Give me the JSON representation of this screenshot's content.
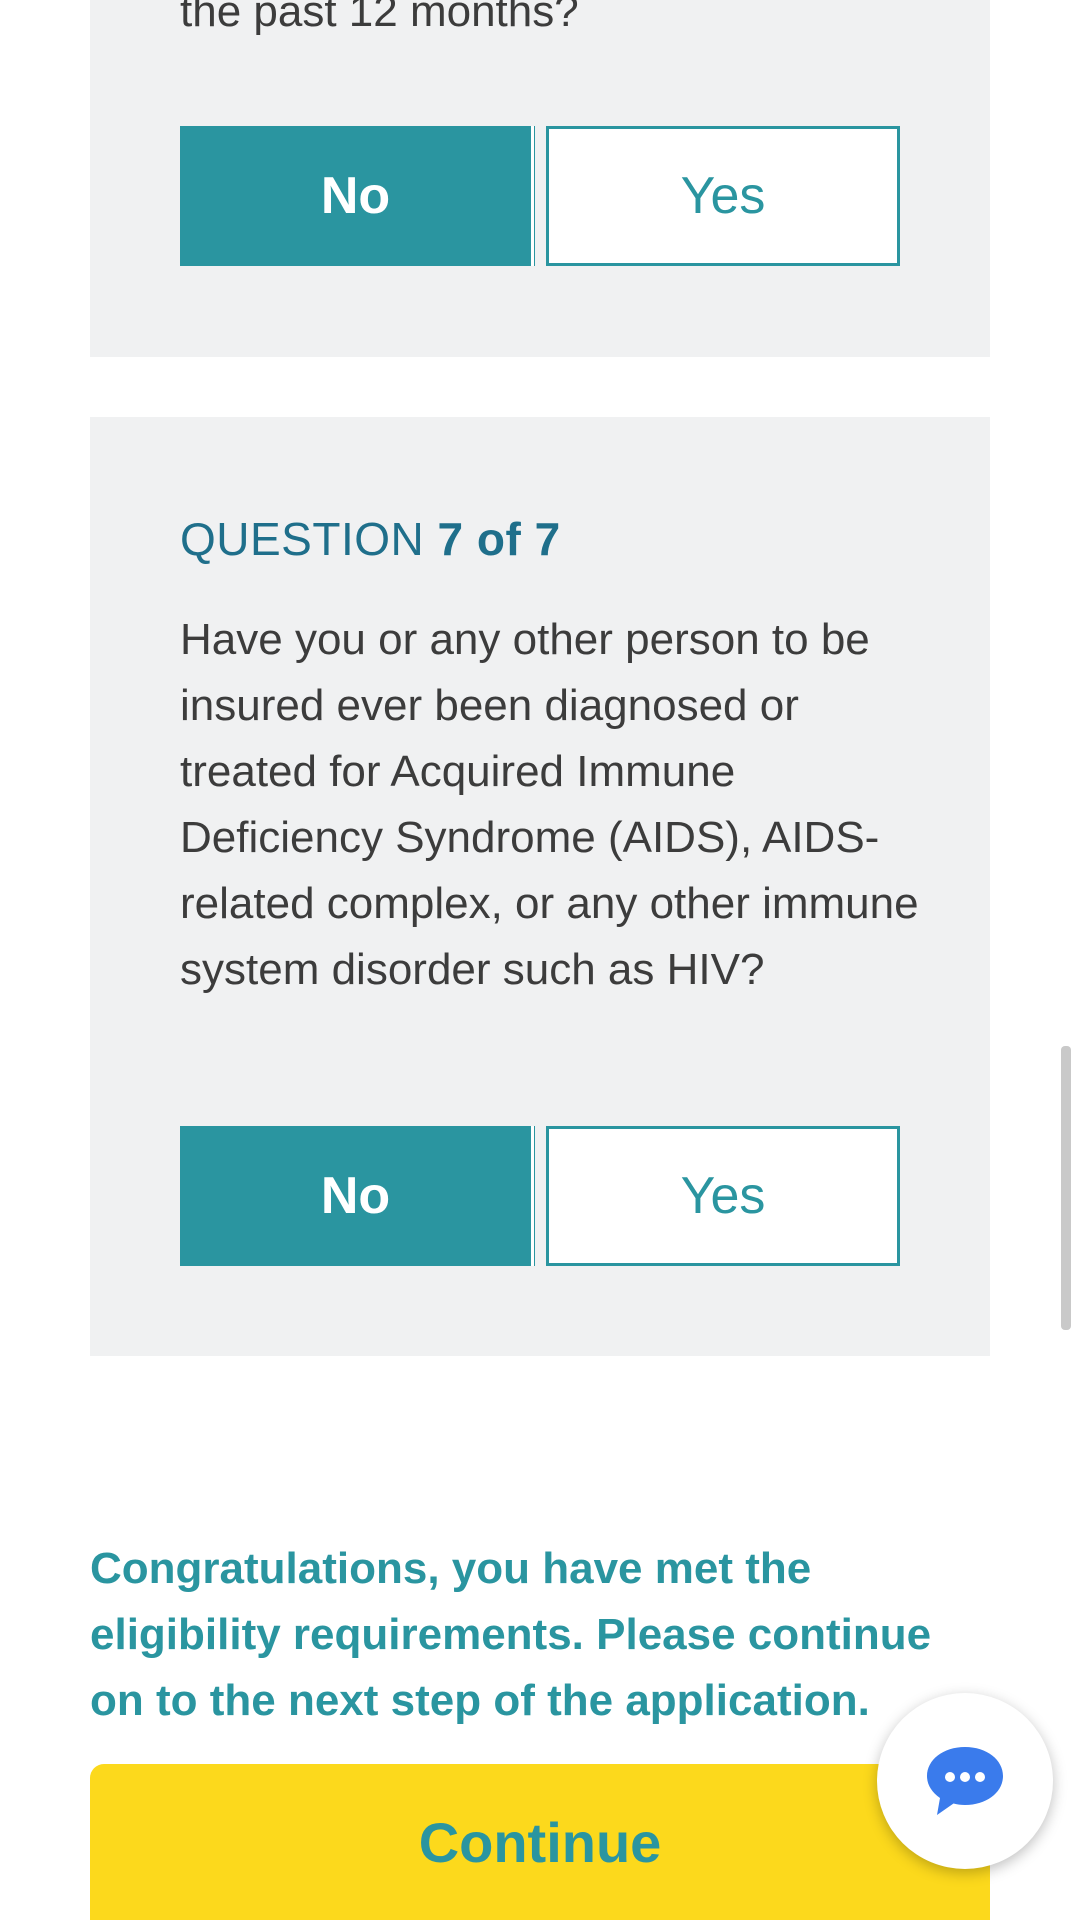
{
  "question6": {
    "text_tail": "the past 12 months?",
    "no_label": "No",
    "yes_label": "Yes"
  },
  "question7": {
    "label_prefix": "QUESTION",
    "label_number": "7 of 7",
    "text": "Have you or any other person to be insured ever been diagnosed or treated for Acquired Immune Deficiency Syndrome (AIDS), AIDS-related complex, or any other immune system disorder such as HIV?",
    "no_label": "No",
    "yes_label": "Yes"
  },
  "eligibility": {
    "message": "Congratulations, you have met the eligibility requirements. Please continue on to the next step of the application."
  },
  "continue_label": "Continue",
  "icons": {
    "chat": "chat-bubble-icon"
  },
  "colors": {
    "teal": "#2a95a0",
    "label_blue": "#1f6f8b",
    "card_bg": "#f0f1f2",
    "continue_yellow": "#fcd91c",
    "chat_blue": "#3a7bec"
  }
}
